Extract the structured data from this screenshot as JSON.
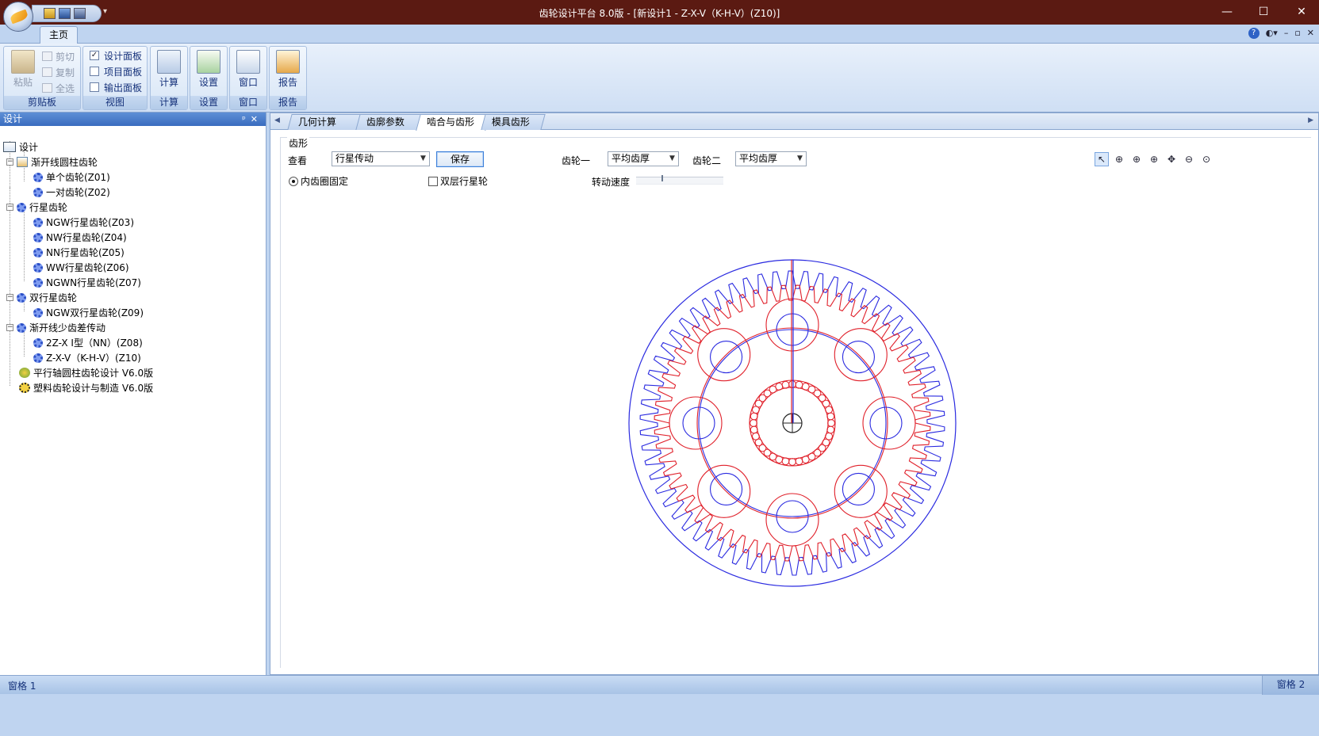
{
  "window": {
    "title": "齿轮设计平台 8.0版 - [新设计1 - Z-X-V（K-H-V）(Z10)]",
    "min_glyph": "—",
    "max_glyph": "☐",
    "close_glyph": "✕"
  },
  "ribbon": {
    "tab_home": "主页",
    "right_glyphs": [
      "▫",
      "✕"
    ],
    "clipboard": {
      "paste": "粘贴",
      "cut": "剪切",
      "copy": "复制",
      "select_all": "全选",
      "label": "剪贴板"
    },
    "view": {
      "design_panel": "设计面板",
      "project_panel": "项目面板",
      "output_panel": "输出面板",
      "label": "视图",
      "design_checked": true
    },
    "calc": {
      "btn": "计算",
      "label": "计算"
    },
    "settings": {
      "btn": "设置",
      "label": "设置"
    },
    "window_grp": {
      "btn": "窗口",
      "label": "窗口"
    },
    "report": {
      "btn": "报告",
      "label": "报告"
    }
  },
  "left_panel": {
    "title": "设计",
    "tree": [
      {
        "label": "设计",
        "level": 0
      },
      {
        "label": "渐开线圆柱齿轮",
        "level": 1
      },
      {
        "label": "单个齿轮(Z01)",
        "level": 2
      },
      {
        "label": "一对齿轮(Z02)",
        "level": 2
      },
      {
        "label": "行星齿轮",
        "level": 1
      },
      {
        "label": "NGW行星齿轮(Z03)",
        "level": 2
      },
      {
        "label": "NW行星齿轮(Z04)",
        "level": 2
      },
      {
        "label": "NN行星齿轮(Z05)",
        "level": 2
      },
      {
        "label": "WW行星齿轮(Z06)",
        "level": 2
      },
      {
        "label": "NGWN行星齿轮(Z07)",
        "level": 2
      },
      {
        "label": "双行星齿轮",
        "level": 1
      },
      {
        "label": "NGW双行星齿轮(Z09)",
        "level": 2
      },
      {
        "label": "渐开线少齿差传动",
        "level": 1
      },
      {
        "label": "2Z-X Ⅰ型（NN）(Z08)",
        "level": 2
      },
      {
        "label": "Z-X-V（K-H-V）(Z10)",
        "level": 2
      },
      {
        "label": "平行轴圆柱齿轮设计 V6.0版",
        "level": 1
      },
      {
        "label": "塑料齿轮设计与制造 V6.0版",
        "level": 1
      }
    ]
  },
  "doc_tabs": [
    "几何计算",
    "齿廓参数",
    "啮合与齿形",
    "模具齿形"
  ],
  "active_tab": 2,
  "form": {
    "group_title": "齿形",
    "view_label": "查看",
    "view_value": "行星传动",
    "save_label": "保存",
    "gear1_label": "齿轮一",
    "gear1_value": "平均齿厚",
    "gear2_label": "齿轮二",
    "gear2_value": "平均齿厚",
    "radio_label": "内齿圈固定",
    "check_label": "双层行星轮",
    "speed_label": "转动速度",
    "speed_level": 0.3
  },
  "colors": {
    "red_gear": "#e0202a",
    "blue_gear": "#2a2ae0",
    "center_mark": "#222222"
  },
  "status": {
    "left": "窗格 1",
    "right": "窗格 2"
  }
}
